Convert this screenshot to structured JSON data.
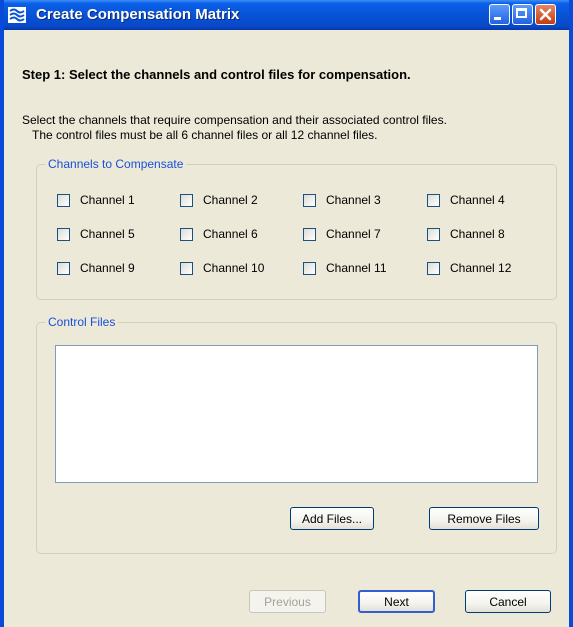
{
  "window": {
    "title": "Create Compensation Matrix",
    "titlebar_color": "#0854d6",
    "icon": "app-logo-icon",
    "controls": [
      "minimize-icon",
      "maximize-icon",
      "close-icon"
    ]
  },
  "step": {
    "title": "Step 1:  Select the channels and control files for compensation."
  },
  "description": {
    "line1": "Select the channels that require compensation and their associated control files.",
    "line2": "The control files must be all 6 channel files or all 12 channel files."
  },
  "channels_group": {
    "legend": "Channels to Compensate",
    "channels": [
      {
        "label": "Channel 1",
        "checked": false
      },
      {
        "label": "Channel 2",
        "checked": false
      },
      {
        "label": "Channel 3",
        "checked": false
      },
      {
        "label": "Channel 4",
        "checked": false
      },
      {
        "label": "Channel 5",
        "checked": false
      },
      {
        "label": "Channel 6",
        "checked": false
      },
      {
        "label": "Channel 7",
        "checked": false
      },
      {
        "label": "Channel 8",
        "checked": false
      },
      {
        "label": "Channel 9",
        "checked": false
      },
      {
        "label": "Channel 10",
        "checked": false
      },
      {
        "label": "Channel 11",
        "checked": false
      },
      {
        "label": "Channel 12",
        "checked": false
      }
    ]
  },
  "files_group": {
    "legend": "Control Files",
    "files": [],
    "add_button": "Add Files...",
    "remove_button": "Remove Files"
  },
  "footer": {
    "previous_button": "Previous",
    "previous_enabled": false,
    "next_button": "Next",
    "cancel_button": "Cancel"
  }
}
